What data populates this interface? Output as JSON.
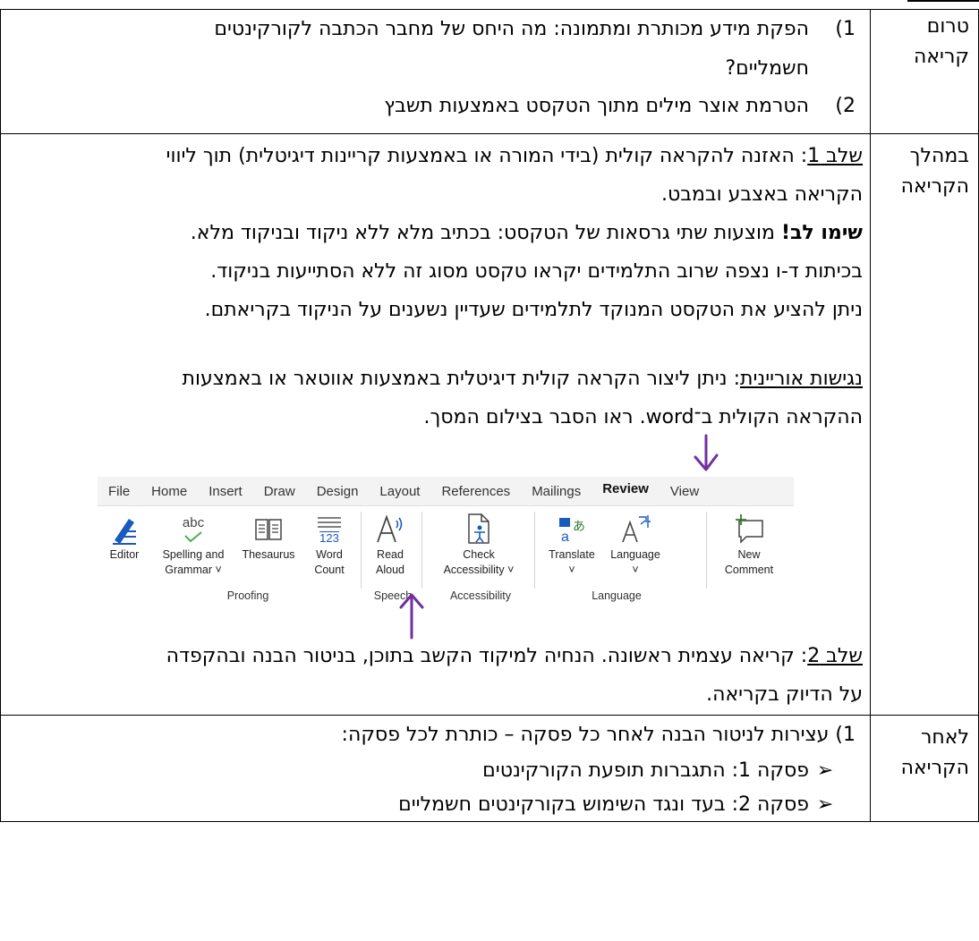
{
  "rows": [
    {
      "label": "טרום קריאה",
      "items": [
        {
          "num": "1)",
          "lines": [
            "הפקת מידע מכותרת ומתמונה: מה היחס של מחבר הכתבה לקורקינטים",
            "חשמליים?"
          ]
        },
        {
          "num": "2)",
          "lines": [
            "הטרמת אוצר מילים מתוך הטקסט באמצעות תשבץ"
          ]
        }
      ]
    },
    {
      "label": "במהלך הקריאה",
      "step1_label": "שלב 1",
      "step1_text": ": האזנה להקראה קולית (בידי המורה או באמצעות קריינות דיגיטלית) תוך ליווי",
      "step1_text2": "הקריאה באצבע ובמבט.",
      "note_bold": "שימו לב!",
      "note_rest": " מוצעות שתי גרסאות של הטקסט: בכתיב מלא ללא ניקוד ובניקוד מלא.",
      "note_line2": "בכיתות ד-ו נצפה שרוב התלמידים יקראו טקסט מסוג זה ללא הסתייעות בניקוד.",
      "note_line3": "ניתן להציע את הטקסט המנוקד לתלמידים שעדיין נשענים על הניקוד בקריאתם.",
      "access_label": "נגישות אוריינית",
      "access_text": ": ניתן ליצור הקראה קולית דיגיטלית באמצעות אווטאר או באמצעות",
      "access_text2": "ההקראה הקולית ב־word. ראו הסבר בצילום המסך.",
      "step2_label": "שלב 2",
      "step2_text": ": קריאה עצמית ראשונה. הנחיה למיקוד הקשב בתוכן, בניטור הבנה ובהקפדה",
      "step2_text2": "על הדיוק בקריאה."
    },
    {
      "label": "לאחר הקריאה",
      "item1": "1) עצירות לניטור הבנה לאחר כל פסקה – כותרת לכל פסקה:",
      "bullets": [
        "פסקה 1: התגברות תופעת הקורקינטים",
        "פסקה 2: בעד ונגד השימוש בקורקינטים חשמליים"
      ]
    }
  ],
  "ribbon": {
    "menu": [
      "File",
      "Home",
      "Insert",
      "Draw",
      "Design",
      "Layout",
      "References",
      "Mailings",
      "Review",
      "View"
    ],
    "active_tab": "Review",
    "tools": {
      "editor": "Editor",
      "spelling1": "Spelling and",
      "spelling2": "Grammar ˅",
      "abc": "abc",
      "thesaurus": "Thesaurus",
      "wordcount1": "Word",
      "wordcount2": "Count",
      "wc_num": "123",
      "readaloud1": "Read",
      "readaloud2": "Aloud",
      "check1": "Check",
      "check2": "Accessibility ˅",
      "translate": "Translate",
      "translate2": "˅",
      "language": "Language",
      "language2": "˅",
      "newcomment1": "New",
      "newcomment2": "Comment"
    },
    "groups": {
      "proofing": "Proofing",
      "speech": "Speech",
      "accessibility": "Accessibility",
      "language": "Language"
    },
    "accent_color": "#185abd",
    "arrow_color": "#7030a0"
  }
}
